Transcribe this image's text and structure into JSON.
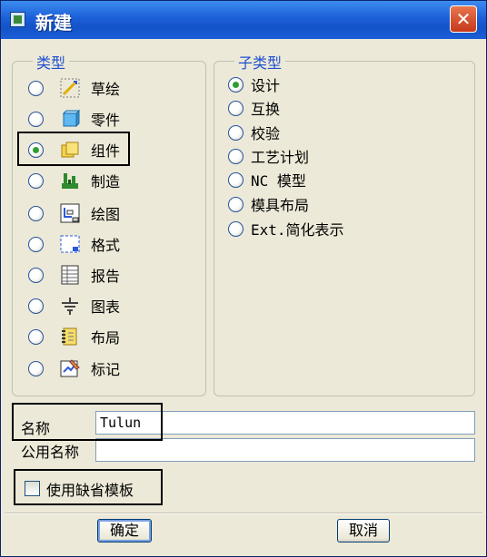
{
  "window": {
    "title": "新建",
    "close_glyph": "✕"
  },
  "type_group": {
    "title": "类型",
    "items": [
      {
        "label": "草绘",
        "icon": "sketch-icon",
        "selected": false
      },
      {
        "label": "零件",
        "icon": "part-icon",
        "selected": false
      },
      {
        "label": "组件",
        "icon": "assembly-icon",
        "selected": true
      },
      {
        "label": "制造",
        "icon": "manufacturing-icon",
        "selected": false
      },
      {
        "label": "绘图",
        "icon": "drawing-icon",
        "selected": false
      },
      {
        "label": "格式",
        "icon": "format-icon",
        "selected": false
      },
      {
        "label": "报告",
        "icon": "report-icon",
        "selected": false
      },
      {
        "label": "图表",
        "icon": "diagram-icon",
        "selected": false
      },
      {
        "label": "布局",
        "icon": "layout-icon",
        "selected": false
      },
      {
        "label": "标记",
        "icon": "markup-icon",
        "selected": false
      }
    ]
  },
  "subtype_group": {
    "title": "子类型",
    "items": [
      {
        "label": "设计",
        "selected": true
      },
      {
        "label": "互换",
        "selected": false
      },
      {
        "label": "校验",
        "selected": false
      },
      {
        "label": "工艺计划",
        "selected": false
      },
      {
        "label": "NC 模型",
        "selected": false
      },
      {
        "label": "模具布局",
        "selected": false
      },
      {
        "label": "Ext.简化表示",
        "selected": false
      }
    ]
  },
  "name_field": {
    "label": "名称",
    "value": "Tulun"
  },
  "common_name_field": {
    "label": "公用名称",
    "value": ""
  },
  "use_default_template": {
    "label": "使用缺省模板",
    "checked": false
  },
  "buttons": {
    "ok": "确定",
    "cancel": "取消"
  }
}
